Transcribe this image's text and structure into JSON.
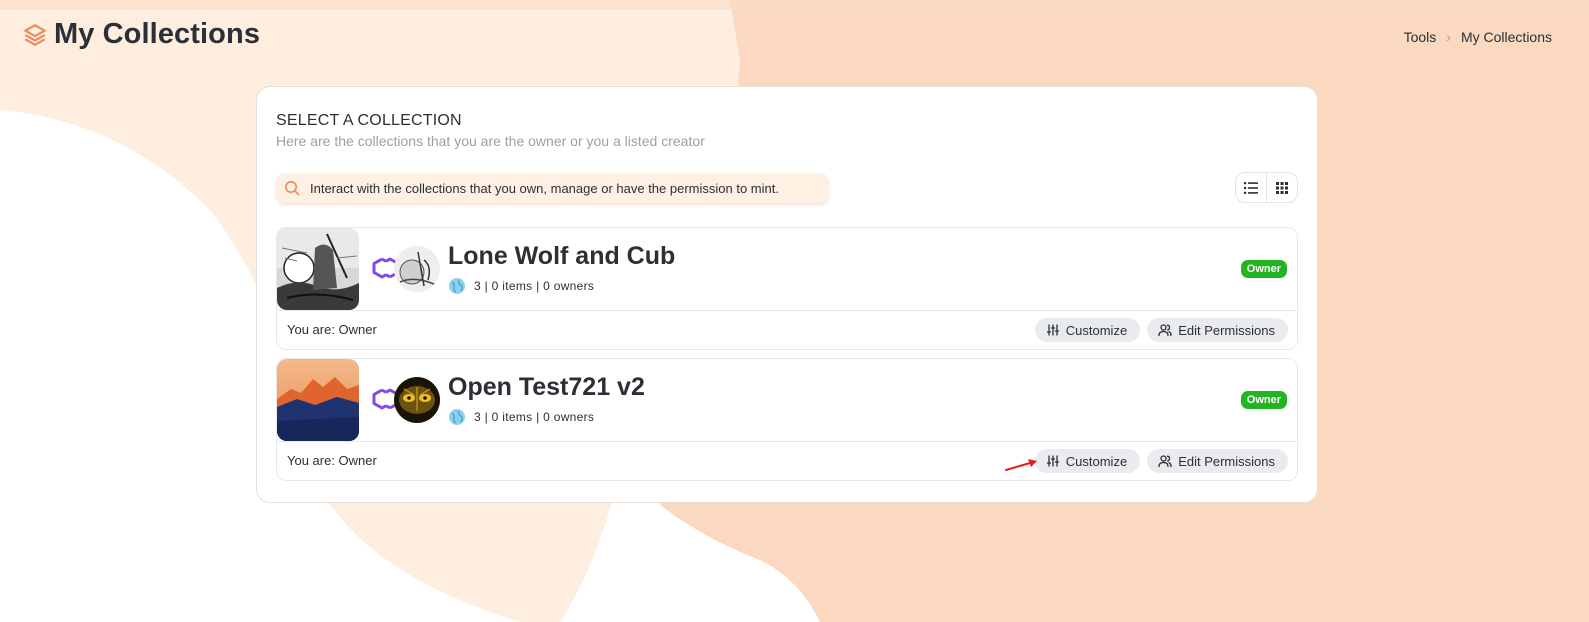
{
  "header": {
    "title": "My Collections",
    "logo_icon": "layers-icon"
  },
  "breadcrumb": {
    "items": [
      "Tools",
      "My Collections"
    ],
    "separator": "›"
  },
  "panel": {
    "title": "SELECT A COLLECTION",
    "subtitle": "Here are the collections that you are the owner or you a listed creator"
  },
  "search": {
    "text": "Interact with the collections that you own, manage or have the permission to mint.",
    "icon": "search-icon"
  },
  "view_toggle": {
    "options": [
      "list-view-icon",
      "grid-view-icon"
    ]
  },
  "collections": [
    {
      "name": "Lone Wolf and Cub",
      "meta": "3 | 0 items | 0 owners",
      "badge": "Owner",
      "role": "You are: Owner",
      "customize_label": "Customize",
      "permissions_label": "Edit Permissions"
    },
    {
      "name": "Open Test721 v2",
      "meta": "3 | 0 items | 0 owners",
      "badge": "Owner",
      "role": "You are: Owner",
      "customize_label": "Customize",
      "permissions_label": "Edit Permissions"
    }
  ],
  "colors": {
    "accent": "#ef8a5c",
    "badge": "#22b422",
    "polygon": "#8247e5",
    "background": "#fdeee0"
  }
}
